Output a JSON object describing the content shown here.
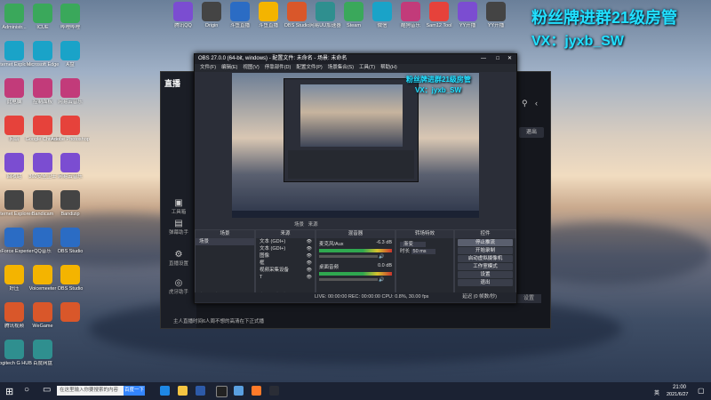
{
  "desktop": {
    "col1": [
      "Administr...",
      "Internet Explorer",
      "此电脑",
      "网络",
      "回收站",
      "Internet Explorer",
      "GeForce Experience",
      "好压",
      "腾讯视频",
      "Logitech G HUB"
    ],
    "col2": [
      "ICUE",
      "Microsoft Edge",
      "控制面板",
      "Google Chrome",
      "360安全卫士",
      "Bandicam",
      "QQ音乐",
      "Voicemeeter",
      "WeGame",
      "百度网盘"
    ],
    "col3": [
      "哔哩哔哩",
      "A盘",
      "网易云音乐",
      "Adobe Photoshop",
      "网易云音乐",
      "Bandizip",
      "OBS Studio",
      "OBS Studio",
      ""
    ],
    "top": [
      "腾讯QQ",
      "Origin",
      "斗鱼直播",
      "斗鱼直播",
      "OBS Studio",
      "网易UU加速器",
      "Steam",
      "微信",
      "酷狗音乐",
      "Sam12 Tool",
      "YY开播",
      "YY开播"
    ]
  },
  "promo": {
    "line1": "粉丝牌进群21级房管",
    "line2": "VX：jyxb_SW"
  },
  "zhibo": {
    "logo": "直播",
    "side": [
      "工具箱",
      "弹幕助手",
      "直播设置",
      "虎牙助手"
    ],
    "right_btn": "退出",
    "bottom_btn": "设置",
    "bottom_text": "主人直播时间6人周不想的高清在下正式播"
  },
  "obs": {
    "title": "OBS 27.0.0 (64-bit, windows) - 配置文件: 未命名 - 场景: 未命名",
    "menu": [
      "文件(F)",
      "编辑(E)",
      "视图(V)",
      "停靠部件(D)",
      "配置文件(P)",
      "场景集合(S)",
      "工具(T)",
      "帮助(H)"
    ],
    "tabs": [
      "场景",
      "来源"
    ],
    "scenes_hd": "场景",
    "scene": "场景",
    "sources_hd": "来源",
    "sources": [
      "文本 (GDI+)",
      "文本 (GDI+)",
      "图像",
      "框",
      "视频采集设备",
      "T"
    ],
    "mixer_hd": "混音器",
    "mixer": [
      {
        "name": "麦克风/Aux",
        "db": "-6.3 dB"
      },
      {
        "name": "桌面音频",
        "db": "0.0 dB"
      }
    ],
    "trans_hd": "转场特效",
    "trans_type": "渐变",
    "trans_dur_label": "时长",
    "trans_dur": "50 ms",
    "ctrl_hd": "控件",
    "controls": [
      "停止推流",
      "开始录制",
      "启动虚拟摄像机",
      "工作室模式",
      "设置",
      "退出"
    ],
    "status": "LIVE: 00:00:00   REC: 00:00:00   CPU: 0.8%, 30.00 fps",
    "status_right": "延迟 (0 帧数/秒)"
  },
  "taskbar": {
    "search": "在这里输入你要搜索的内容",
    "search_btn": "百度一下",
    "time": "21:00",
    "date": "2021/6/27",
    "lang": "英"
  }
}
